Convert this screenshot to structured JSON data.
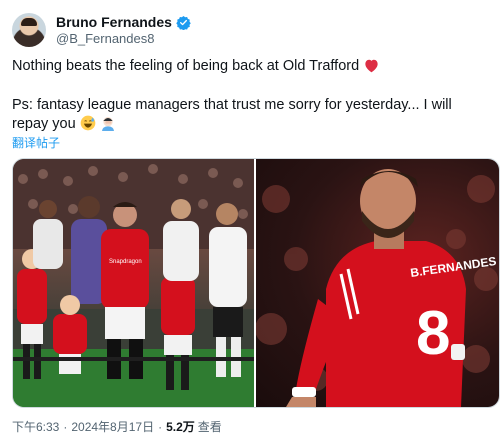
{
  "author": {
    "display_name": "Bruno Fernandes",
    "handle": "@B_Fernandes8",
    "verified": true
  },
  "tweet": {
    "line1_text": "Nothing beats the feeling of being back at Old Trafford",
    "line1_emoji": "❤️",
    "line2_text": "Ps: fantasy league managers that trust me sorry for yesterday... I will repay you",
    "line2_emojis": "😅 🤦🏻‍♂️",
    "translate_label": "翻译帖子"
  },
  "media": {
    "images": [
      {
        "name": "photo-walkout",
        "shirt_text": "Snapdragon",
        "kit_number": ""
      },
      {
        "name": "photo-bruno",
        "shirt_text": "B.FERNANDES",
        "kit_number": "8"
      }
    ]
  },
  "meta": {
    "time": "下午6:33",
    "date": "2024年8月17日",
    "separator": "·",
    "views_count": "5.2万",
    "views_label": "查看"
  },
  "colors": {
    "link_blue": "#1d9bf0",
    "verified_blue": "#1d9bf0",
    "secondary_text": "#536471",
    "man_utd_red": "#d4101d"
  }
}
